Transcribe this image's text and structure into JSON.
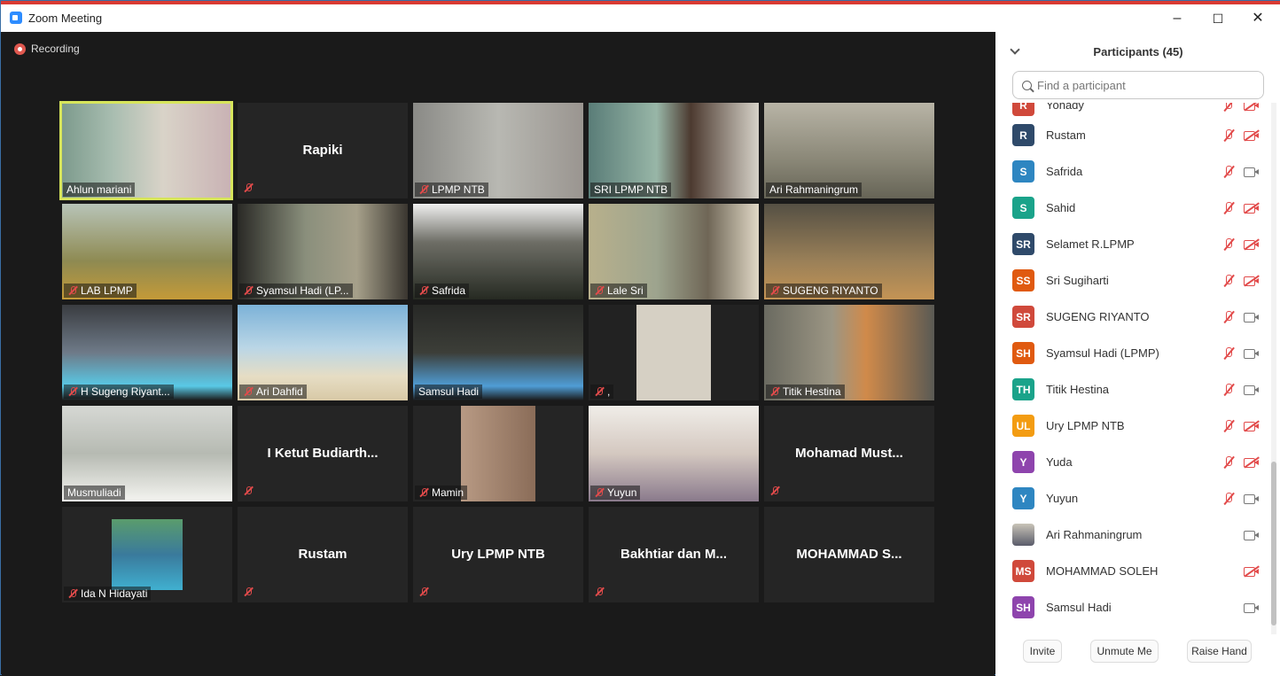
{
  "window": {
    "title": "Zoom Meeting"
  },
  "recording": {
    "label": "Recording"
  },
  "grid": [
    {
      "name": "Ahlun mariani",
      "muted": false,
      "video": true,
      "active": true
    },
    {
      "name": "Rapiki",
      "muted": true,
      "video": false
    },
    {
      "name": "LPMP NTB",
      "muted": true,
      "video": true
    },
    {
      "name": "SRI LPMP NTB",
      "muted": false,
      "video": true
    },
    {
      "name": "Ari Rahmaningrum",
      "muted": false,
      "video": true
    },
    {
      "name": "LAB LPMP",
      "muted": true,
      "video": true
    },
    {
      "name": "Syamsul Hadi (LP...",
      "muted": true,
      "video": true
    },
    {
      "name": "Safrida",
      "muted": true,
      "video": true
    },
    {
      "name": "Lale Sri",
      "muted": true,
      "video": true
    },
    {
      "name": "SUGENG RIYANTO",
      "muted": true,
      "video": true
    },
    {
      "name": "H Sugeng Riyant...",
      "muted": true,
      "video": true
    },
    {
      "name": "Ari Dahfid",
      "muted": true,
      "video": true
    },
    {
      "name": "Samsul Hadi",
      "muted": false,
      "video": true
    },
    {
      "name": ",",
      "muted": true,
      "video": true
    },
    {
      "name": "Titik Hestina",
      "muted": true,
      "video": true
    },
    {
      "name": "Musmuliadi",
      "muted": false,
      "video": true
    },
    {
      "name": "I Ketut Budiarth...",
      "muted": true,
      "video": false
    },
    {
      "name": "Mamin",
      "muted": true,
      "video": true
    },
    {
      "name": "Yuyun",
      "muted": true,
      "video": true
    },
    {
      "name": "Mohamad Must...",
      "muted": true,
      "video": false
    },
    {
      "name": "Ida N Hidayati",
      "muted": true,
      "video": true
    },
    {
      "name": "Rustam",
      "muted": true,
      "video": false
    },
    {
      "name": "Ury LPMP NTB",
      "muted": true,
      "video": false
    },
    {
      "name": "Bakhtiar dan M...",
      "muted": true,
      "video": false
    },
    {
      "name": "MOHAMMAD S...",
      "muted": false,
      "video": false
    }
  ],
  "panel": {
    "title": "Participants (45)",
    "search_placeholder": "Find a participant",
    "participants": [
      {
        "initials": "R",
        "name": "Yohady",
        "color": "#d0493b",
        "mic_muted": true,
        "cam_off": true
      },
      {
        "initials": "R",
        "name": "Rustam",
        "color": "#2f4a6a",
        "mic_muted": true,
        "cam_off": true
      },
      {
        "initials": "S",
        "name": "Safrida",
        "color": "#2e86c1",
        "mic_muted": true,
        "cam_off": false
      },
      {
        "initials": "S",
        "name": "Sahid",
        "color": "#1aa38a",
        "mic_muted": true,
        "cam_off": true
      },
      {
        "initials": "SR",
        "name": "Selamet R.LPMP",
        "color": "#2f4a6a",
        "mic_muted": true,
        "cam_off": true
      },
      {
        "initials": "SS",
        "name": "Sri Sugiharti",
        "color": "#e05a10",
        "mic_muted": true,
        "cam_off": true
      },
      {
        "initials": "SR",
        "name": "SUGENG RIYANTO",
        "color": "#d0493b",
        "mic_muted": true,
        "cam_off": false
      },
      {
        "initials": "SH",
        "name": "Syamsul Hadi (LPMP)",
        "color": "#e05a10",
        "mic_muted": true,
        "cam_off": false
      },
      {
        "initials": "TH",
        "name": "Titik Hestina",
        "color": "#1aa38a",
        "mic_muted": true,
        "cam_off": false
      },
      {
        "initials": "UL",
        "name": "Ury LPMP NTB",
        "color": "#f39c12",
        "mic_muted": true,
        "cam_off": true
      },
      {
        "initials": "Y",
        "name": "Yuda",
        "color": "#8e44ad",
        "mic_muted": true,
        "cam_off": true
      },
      {
        "initials": "Y",
        "name": "Yuyun",
        "color": "#2e86c1",
        "mic_muted": true,
        "cam_off": false
      },
      {
        "initials": "",
        "name": "Ari Rahmaningrum",
        "color": "#8a8f9a",
        "mic_muted": false,
        "cam_off": false,
        "photo": true
      },
      {
        "initials": "MS",
        "name": "MOHAMMAD SOLEH",
        "color": "#d0493b",
        "mic_muted": false,
        "cam_off": true
      },
      {
        "initials": "SH",
        "name": "Samsul Hadi",
        "color": "#8e44ad",
        "mic_muted": false,
        "cam_off": false
      }
    ],
    "buttons": {
      "invite": "Invite",
      "unmute": "Unmute Me",
      "raise_hand": "Raise Hand"
    }
  }
}
